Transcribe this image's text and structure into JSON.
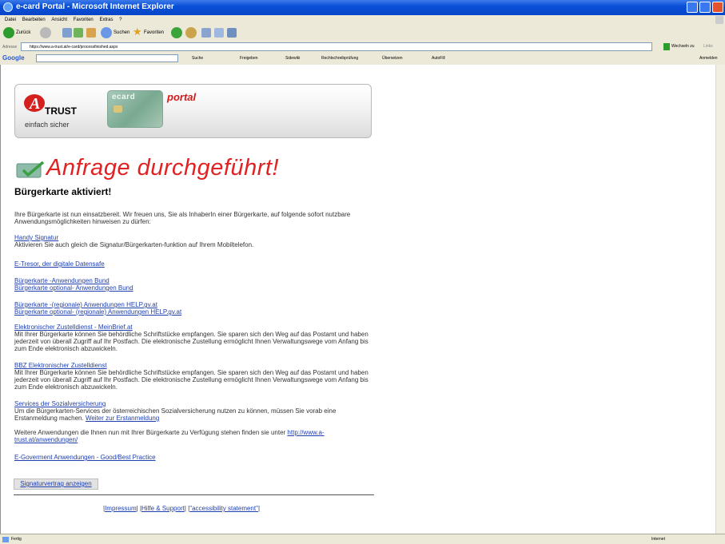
{
  "window": {
    "title": "e-card Portal - Microsoft Internet Explorer"
  },
  "menu": [
    "Datei",
    "Bearbeiten",
    "Ansicht",
    "Favoriten",
    "Extras",
    "?"
  ],
  "toolbar": {
    "back": "Zurück",
    "search": "Suchen",
    "favorites": "Favoriten"
  },
  "address": {
    "label": "Adresse",
    "url": "https://www.a-trust.at/e-card/processfinished.aspx",
    "go": "Wechseln zu",
    "links": "Links"
  },
  "google": {
    "logo": "Google",
    "items": [
      "Suche",
      "Freigeben",
      "Sidewiki",
      "Rechtschreibprüfung",
      "Übersetzen",
      "AutoFill"
    ],
    "signin": "Anmelden"
  },
  "banner": {
    "trust": "TRUST",
    "tagline": "einfach sicher",
    "card_text": "ecard",
    "portal": "portal"
  },
  "page": {
    "headline": "Anfrage durchgeführt!",
    "subheading": "Bürgerkarte aktiviert!",
    "intro": "Ihre Bürgerkarte ist nun einsatzbereit. Wir freuen uns, Sie als InhaberIn einer Bürgerkarte, auf folgende sofort nutzbare Anwendungsmöglichkeiten hinweisen zu dürfen:",
    "handy_link": "Handy Signatur",
    "handy_text": "Aktivieren Sie auch gleich die Signatur/Bürgerkarten-funktion auf Ihrem Mobiltelefon.",
    "etresor_link": "E-Tresor, der digitale Datensafe",
    "bund_link1": "Bürgerkarte -Anwendungen Bund",
    "bund_link2": "Bürgerkarte optional- Anwendungen Bund",
    "help_link1": "Bürgerkarte -(regionale) Anwendungen HELP.gv.at",
    "help_link2": "Bürgerkarte optional- (regionale) Anwendungen HELP.gv.at",
    "zustell_link": "Elektronischer Zustelldienst - MeinBrief.at",
    "zustell_text": "Mit Ihrer Bürgerkarte können Sie behördliche Schriftstücke empfangen. Sie sparen sich den Weg auf das Postamt und haben jederzeit von überall Zugriff auf Ihr Postfach. Die elektronische Zustellung ermöglicht Ihnen Verwaltungswege vom Anfang bis zum Ende elektronisch abzuwickeln.",
    "bbz_link": "BBZ Elektronischer Zustelldienst",
    "bbz_text": "Mit Ihrer Bürgerkarte können Sie behördliche Schriftstücke empfangen. Sie sparen sich den Weg auf das Postamt und haben jederzeit von überall Zugriff auf Ihr Postfach. Die elektronische Zustellung ermöglicht Ihnen Verwaltungswege vom Anfang bis zum Ende elektronisch abzuwickeln.",
    "sv_link": "Services der Sozialversicherung",
    "sv_text": "Um die Bürgerkarten-Services der österreichischen Sozialversicherung nutzen zu können, müssen Sie vorab eine Erstanmeldung machen.",
    "sv_more": "Weiter zur Erstanmeldung",
    "more_text": "Weitere Anwendungen die Ihnen nun mit Ihrer Bürgerkarte zu Verfügung stehen finden sie unter",
    "more_link": "http://www.a-trust.at/anwendungen/",
    "egov_link": "E-Goverment Anwendungen - Good/Best Practice",
    "sig_button": "Signaturvertrag anzeigen",
    "footer_impressum": "Impressum",
    "footer_hilfe": "Hilfe & Support",
    "footer_access": "\"accessibility statement\""
  },
  "status": {
    "left": "Fertig",
    "zone": "Internet"
  }
}
